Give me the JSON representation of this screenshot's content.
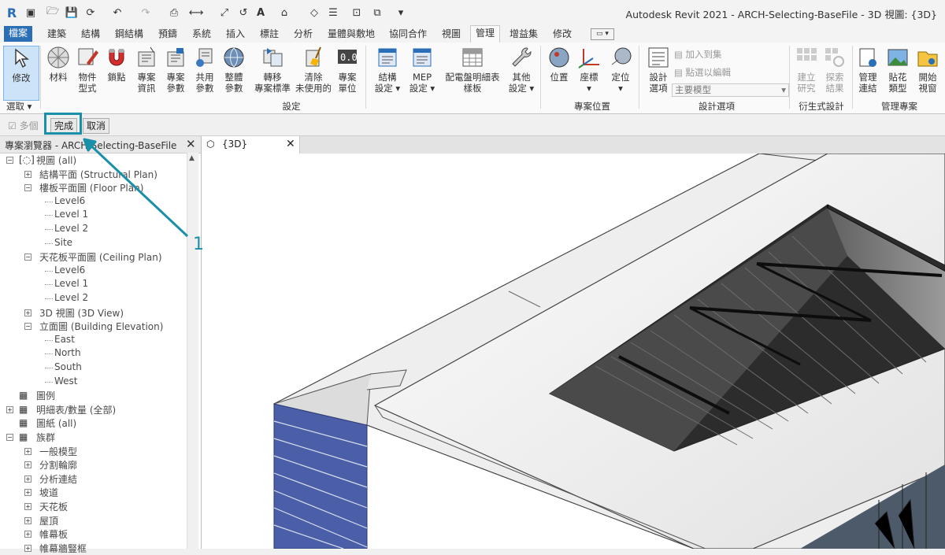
{
  "app": {
    "title": "Autodesk Revit 2021 - ARCH-Selecting-BaseFile - 3D 視圖: {3D}",
    "logo": "R"
  },
  "tabs": [
    "檔案",
    "建築",
    "結構",
    "鋼結構",
    "預鑄",
    "系統",
    "插入",
    "標註",
    "分析",
    "量體與敷地",
    "協同合作",
    "視圖",
    "管理",
    "增益集",
    "修改"
  ],
  "active_tab": "管理",
  "ribbon": {
    "select": {
      "modify": "修改",
      "select_label": "選取"
    },
    "settings_buttons": [
      {
        "label1": "材料",
        "label2": ""
      },
      {
        "label1": "物件",
        "label2": "型式"
      },
      {
        "label1": "鎖點",
        "label2": ""
      },
      {
        "label1": "專案",
        "label2": "資訊"
      },
      {
        "label1": "專案",
        "label2": "參數"
      },
      {
        "label1": "共用",
        "label2": "參數"
      },
      {
        "label1": "整體",
        "label2": "參數"
      },
      {
        "label1": "轉移",
        "label2": "專案標準"
      },
      {
        "label1": "清除",
        "label2": "未使用的"
      },
      {
        "label1": "專案",
        "label2": "單位"
      },
      {
        "label1": "結構",
        "label2": "設定"
      },
      {
        "label1": "MEP",
        "label2": "設定"
      },
      {
        "label1": "配電盤明細表",
        "label2": "樣板"
      },
      {
        "label1": "其他",
        "label2": "設定"
      }
    ],
    "group_settings": "設定",
    "location_buttons": [
      {
        "label1": "位置",
        "label2": ""
      },
      {
        "label1": "座標",
        "label2": ""
      },
      {
        "label1": "定位",
        "label2": ""
      }
    ],
    "group_location": "專案位置",
    "design_options": {
      "button1": "設計",
      "button2": "選項",
      "add_to_set": "加入到集",
      "pick_to_edit": "點選以編輯",
      "main_model": "主要模型",
      "group": "設計選項"
    },
    "derived": {
      "b1a": "建立",
      "b1b": "研究",
      "b2a": "探索",
      "b2b": "結果",
      "group": "衍生式設計"
    },
    "manage_project": {
      "b1a": "管理",
      "b1b": "連結",
      "b2a": "貼花",
      "b2b": "類型",
      "b3a": "開始",
      "b3b": "開始",
      "b3b_real": "視窗",
      "group": "管理專案"
    }
  },
  "options_bar": {
    "multiple": "多個",
    "finish": "完成",
    "cancel": "取消"
  },
  "project_browser": {
    "title": "專案瀏覽器 - ARCH-Selecting-BaseFile",
    "items": [
      "視圖 (all)",
      "結構平面 (Structural Plan)",
      "樓板平面圖 (Floor Plan)",
      "Level6",
      "Level 1",
      "Level 2",
      "Site",
      "天花板平面圖 (Ceiling Plan)",
      "Level6",
      "Level 1",
      "Level 2",
      "3D 視圖 (3D View)",
      "立面圖 (Building Elevation)",
      "East",
      "North",
      "South",
      "West",
      "圖例",
      "明細表/數量 (全部)",
      "圖紙 (all)",
      "族群",
      "一般模型",
      "分割輪廓",
      "分析連結",
      "坡道",
      "天花板",
      "屋頂",
      "帷幕板",
      "帷幕牆豎框"
    ]
  },
  "view_tab": "{3D}",
  "annotation": {
    "callout_number": "1",
    "color": "#1a8fa8"
  },
  "colors": {
    "file_tab": "#2a6fb5",
    "callout": "#1a8fa8",
    "glass": "#4a5fa8"
  }
}
